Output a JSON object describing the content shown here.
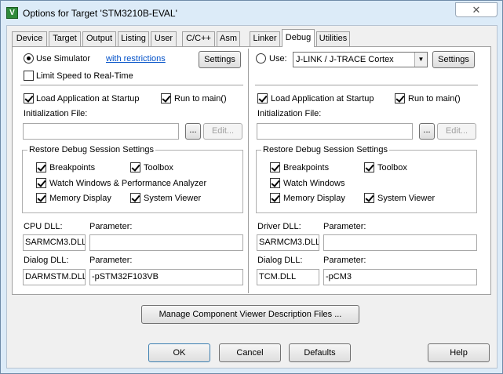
{
  "window": {
    "title": "Options for Target 'STM3210B-EVAL'",
    "close_label": "✕"
  },
  "tabs": [
    "Device",
    "Target",
    "Output",
    "Listing",
    "User",
    "C/C++",
    "Asm",
    "Linker",
    "Debug",
    "Utilities"
  ],
  "active_tab": "Debug",
  "left": {
    "use_simulator_label": "Use Simulator",
    "restrictions_link": "with restrictions",
    "settings_label": "Settings",
    "limit_speed_label": "Limit Speed to Real-Time",
    "load_app_label": "Load Application at Startup",
    "run_to_main_label": "Run to main()",
    "init_file_label": "Initialization File:",
    "init_file_value": "",
    "browse_label": "...",
    "edit_label": "Edit...",
    "restore_group_label": "Restore Debug Session Settings",
    "breakpoints_label": "Breakpoints",
    "toolbox_label": "Toolbox",
    "watch_label": "Watch Windows & Performance Analyzer",
    "memory_label": "Memory Display",
    "system_viewer_label": "System Viewer",
    "dll_label": "CPU DLL:",
    "dll_param_label": "Parameter:",
    "dll_value": "SARMCM3.DLL",
    "dll_param_value": "",
    "dialog_dll_label": "Dialog DLL:",
    "dialog_param_label": "Parameter:",
    "dialog_dll_value": "DARMSTM.DLL",
    "dialog_param_value": "-pSTM32F103VB"
  },
  "right": {
    "use_label": "Use:",
    "debugger_value": "J-LINK / J-TRACE Cortex",
    "settings_label": "Settings",
    "load_app_label": "Load Application at Startup",
    "run_to_main_label": "Run to main()",
    "init_file_label": "Initialization File:",
    "init_file_value": "",
    "browse_label": "...",
    "edit_label": "Edit...",
    "restore_group_label": "Restore Debug Session Settings",
    "breakpoints_label": "Breakpoints",
    "toolbox_label": "Toolbox",
    "watch_label": "Watch Windows",
    "memory_label": "Memory Display",
    "system_viewer_label": "System Viewer",
    "dll_label": "Driver DLL:",
    "dll_param_label": "Parameter:",
    "dll_value": "SARMCM3.DLL",
    "dll_param_value": "",
    "dialog_dll_label": "Dialog DLL:",
    "dialog_param_label": "Parameter:",
    "dialog_dll_value": "TCM.DLL",
    "dialog_param_value": "-pCM3"
  },
  "manage_button_label": "Manage Component Viewer Description Files ...",
  "footer": {
    "ok": "OK",
    "cancel": "Cancel",
    "defaults": "Defaults",
    "help": "Help"
  }
}
